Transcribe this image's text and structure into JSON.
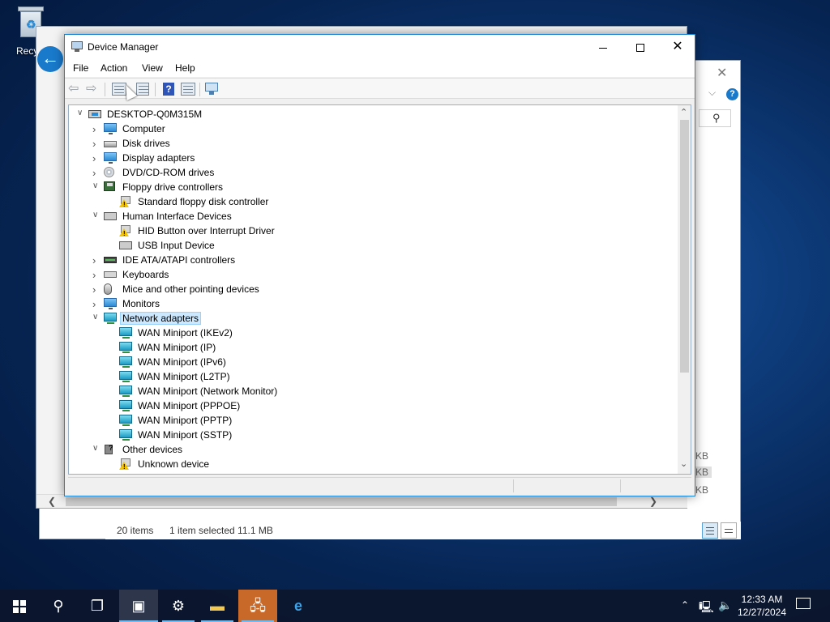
{
  "desktop": {
    "recycle_bin_label": "Recycl"
  },
  "explorer": {
    "status_items": "20 items",
    "status_selected": "1 item selected  11.1 MB",
    "size_labels": [
      "KB",
      "KB",
      "KB"
    ]
  },
  "device_manager": {
    "title": "Device Manager",
    "menu": [
      "File",
      "Action",
      "View",
      "Help"
    ],
    "tree": [
      {
        "label": "DESKTOP-Q0M315M",
        "level": 0,
        "state": "expanded",
        "icon": "computer-icon"
      },
      {
        "label": "Computer",
        "level": 1,
        "state": "collapsed",
        "icon": "monitor-icon"
      },
      {
        "label": "Disk drives",
        "level": 1,
        "state": "collapsed",
        "icon": "disk-drive-icon"
      },
      {
        "label": "Display adapters",
        "level": 1,
        "state": "collapsed",
        "icon": "display-adapter-icon"
      },
      {
        "label": "DVD/CD-ROM drives",
        "level": 1,
        "state": "collapsed",
        "icon": "cd-drive-icon"
      },
      {
        "label": "Floppy drive controllers",
        "level": 1,
        "state": "expanded",
        "icon": "floppy-controller-icon"
      },
      {
        "label": "Standard floppy disk controller",
        "level": 2,
        "state": "leaf",
        "icon": "warning-device-icon"
      },
      {
        "label": "Human Interface Devices",
        "level": 1,
        "state": "expanded",
        "icon": "hid-icon"
      },
      {
        "label": "HID Button over Interrupt Driver",
        "level": 2,
        "state": "leaf",
        "icon": "warning-device-icon"
      },
      {
        "label": "USB Input Device",
        "level": 2,
        "state": "leaf",
        "icon": "hid-icon"
      },
      {
        "label": "IDE ATA/ATAPI controllers",
        "level": 1,
        "state": "collapsed",
        "icon": "ide-controller-icon"
      },
      {
        "label": "Keyboards",
        "level": 1,
        "state": "collapsed",
        "icon": "keyboard-icon"
      },
      {
        "label": "Mice and other pointing devices",
        "level": 1,
        "state": "collapsed",
        "icon": "mouse-icon"
      },
      {
        "label": "Monitors",
        "level": 1,
        "state": "collapsed",
        "icon": "monitor-icon"
      },
      {
        "label": "Network adapters",
        "level": 1,
        "state": "expanded",
        "icon": "network-adapter-icon",
        "selected": true
      },
      {
        "label": "WAN Miniport (IKEv2)",
        "level": 2,
        "state": "leaf",
        "icon": "network-adapter-icon"
      },
      {
        "label": "WAN Miniport (IP)",
        "level": 2,
        "state": "leaf",
        "icon": "network-adapter-icon"
      },
      {
        "label": "WAN Miniport (IPv6)",
        "level": 2,
        "state": "leaf",
        "icon": "network-adapter-icon"
      },
      {
        "label": "WAN Miniport (L2TP)",
        "level": 2,
        "state": "leaf",
        "icon": "network-adapter-icon"
      },
      {
        "label": "WAN Miniport (Network Monitor)",
        "level": 2,
        "state": "leaf",
        "icon": "network-adapter-icon"
      },
      {
        "label": "WAN Miniport (PPPOE)",
        "level": 2,
        "state": "leaf",
        "icon": "network-adapter-icon"
      },
      {
        "label": "WAN Miniport (PPTP)",
        "level": 2,
        "state": "leaf",
        "icon": "network-adapter-icon"
      },
      {
        "label": "WAN Miniport (SSTP)",
        "level": 2,
        "state": "leaf",
        "icon": "network-adapter-icon"
      },
      {
        "label": "Other devices",
        "level": 1,
        "state": "expanded",
        "icon": "other-devices-icon"
      },
      {
        "label": "Unknown device",
        "level": 2,
        "state": "leaf",
        "icon": "warning-device-icon"
      }
    ]
  },
  "taskbar": {
    "time": "12:33 AM",
    "date": "12/27/2024"
  }
}
